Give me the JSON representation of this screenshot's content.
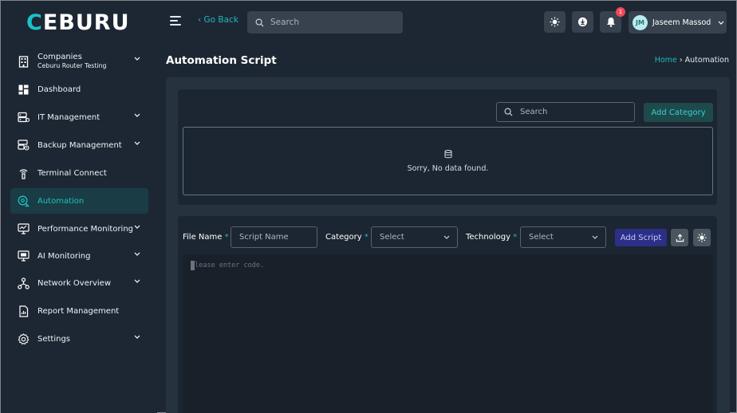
{
  "app": {
    "logo_text": "CEBURU",
    "accent_color": "#19c2c6"
  },
  "topbar": {
    "go_back": "‹ Go Back",
    "search_placeholder": "Search",
    "notification_count": "1",
    "user_initials": "JM",
    "user_name": "Jaseem Massod"
  },
  "sidebar": {
    "company_label": "Companies",
    "company_name": "Ceburu Router Testing",
    "items": [
      {
        "label": "Dashboard",
        "icon": "dashboard-icon"
      },
      {
        "label": "IT Management",
        "icon": "server-icon"
      },
      {
        "label": "Backup Management",
        "icon": "backup-icon"
      },
      {
        "label": "Terminal Connect",
        "icon": "terminal-icon"
      },
      {
        "label": "Automation",
        "icon": "automation-icon"
      },
      {
        "label": "Performance Monitoring",
        "icon": "monitor-icon"
      },
      {
        "label": "AI Monitoring",
        "icon": "ai-monitor-icon"
      },
      {
        "label": "Network Overview",
        "icon": "network-icon"
      },
      {
        "label": "Report Management",
        "icon": "report-icon"
      },
      {
        "label": "Settings",
        "icon": "gear-icon"
      }
    ]
  },
  "page": {
    "title": "Automation Script",
    "breadcrumb_home": "Home",
    "breadcrumb_sep": "›",
    "breadcrumb_current": "Automation"
  },
  "category": {
    "search_placeholder": "Search",
    "add_button": "Add Category",
    "empty_message": "Sorry, No data found."
  },
  "script_form": {
    "file_name_label": "File Name",
    "file_name_placeholder": "Script Name",
    "category_label": "Category",
    "category_value": "Select",
    "technology_label": "Technology",
    "technology_value": "Select",
    "required_mark": "*",
    "add_button": "Add Script",
    "editor_placeholder": "Please enter  code."
  }
}
